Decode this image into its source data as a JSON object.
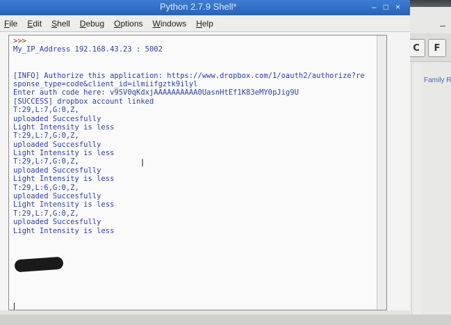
{
  "window": {
    "title": "Python 2.7.9 Shell*",
    "controls": {
      "minimize": "–",
      "maximize": "□",
      "close": "×"
    }
  },
  "menu": [
    "File",
    "Edit",
    "Shell",
    "Debug",
    "Options",
    "Windows",
    "Help"
  ],
  "shell_lines": [
    {
      "kind": "prompt",
      "text": ">>>"
    },
    {
      "kind": "out",
      "text": "My_IP_Address 192.168.43.23 : 5002"
    },
    {
      "kind": "blank",
      "text": ""
    },
    {
      "kind": "blank",
      "text": ""
    },
    {
      "kind": "out",
      "text": "[INFO] Authorize this application: https://www.dropbox.com/1/oauth2/authorize?re"
    },
    {
      "kind": "out",
      "text": "sponse_type=code&client_id=ilmiifgztk9ilyl"
    },
    {
      "kind": "out",
      "text": "Enter auth code here: v9SV0qKdxjAAAAAAAAAA0UasnHtEf1K83eMY0pJig9U"
    },
    {
      "kind": "out",
      "text": "[SUCCESS] dropbox account linked"
    },
    {
      "kind": "out",
      "text": "T:29,L:7,G:0,Z,"
    },
    {
      "kind": "out",
      "text": "uploaded Succesfully"
    },
    {
      "kind": "out",
      "text": "Light Intensity is less"
    },
    {
      "kind": "out",
      "text": "T:29,L:7,G:0,Z,"
    },
    {
      "kind": "out",
      "text": "uploaded Succesfully"
    },
    {
      "kind": "out",
      "text": "Light Intensity is less"
    },
    {
      "kind": "out",
      "text": "T:29,L:7,G:0,Z,"
    },
    {
      "kind": "out",
      "text": "uploaded Succesfully"
    },
    {
      "kind": "out",
      "text": "Light Intensity is less"
    },
    {
      "kind": "out",
      "text": "T:29,L:6,G:0,Z,"
    },
    {
      "kind": "out",
      "text": "uploaded Succesfully"
    },
    {
      "kind": "out",
      "text": "Light Intensity is less"
    },
    {
      "kind": "out",
      "text": "T:29,L:7,G:0,Z,"
    },
    {
      "kind": "out",
      "text": "uploaded Succesfully"
    },
    {
      "kind": "out",
      "text": "Light Intensity is less"
    }
  ],
  "background_window": {
    "buttons": [
      "C",
      "F"
    ],
    "side_text": "Family Robot",
    "minimize": "–"
  },
  "icons": {
    "text-cursor": "i-beam-icon"
  }
}
